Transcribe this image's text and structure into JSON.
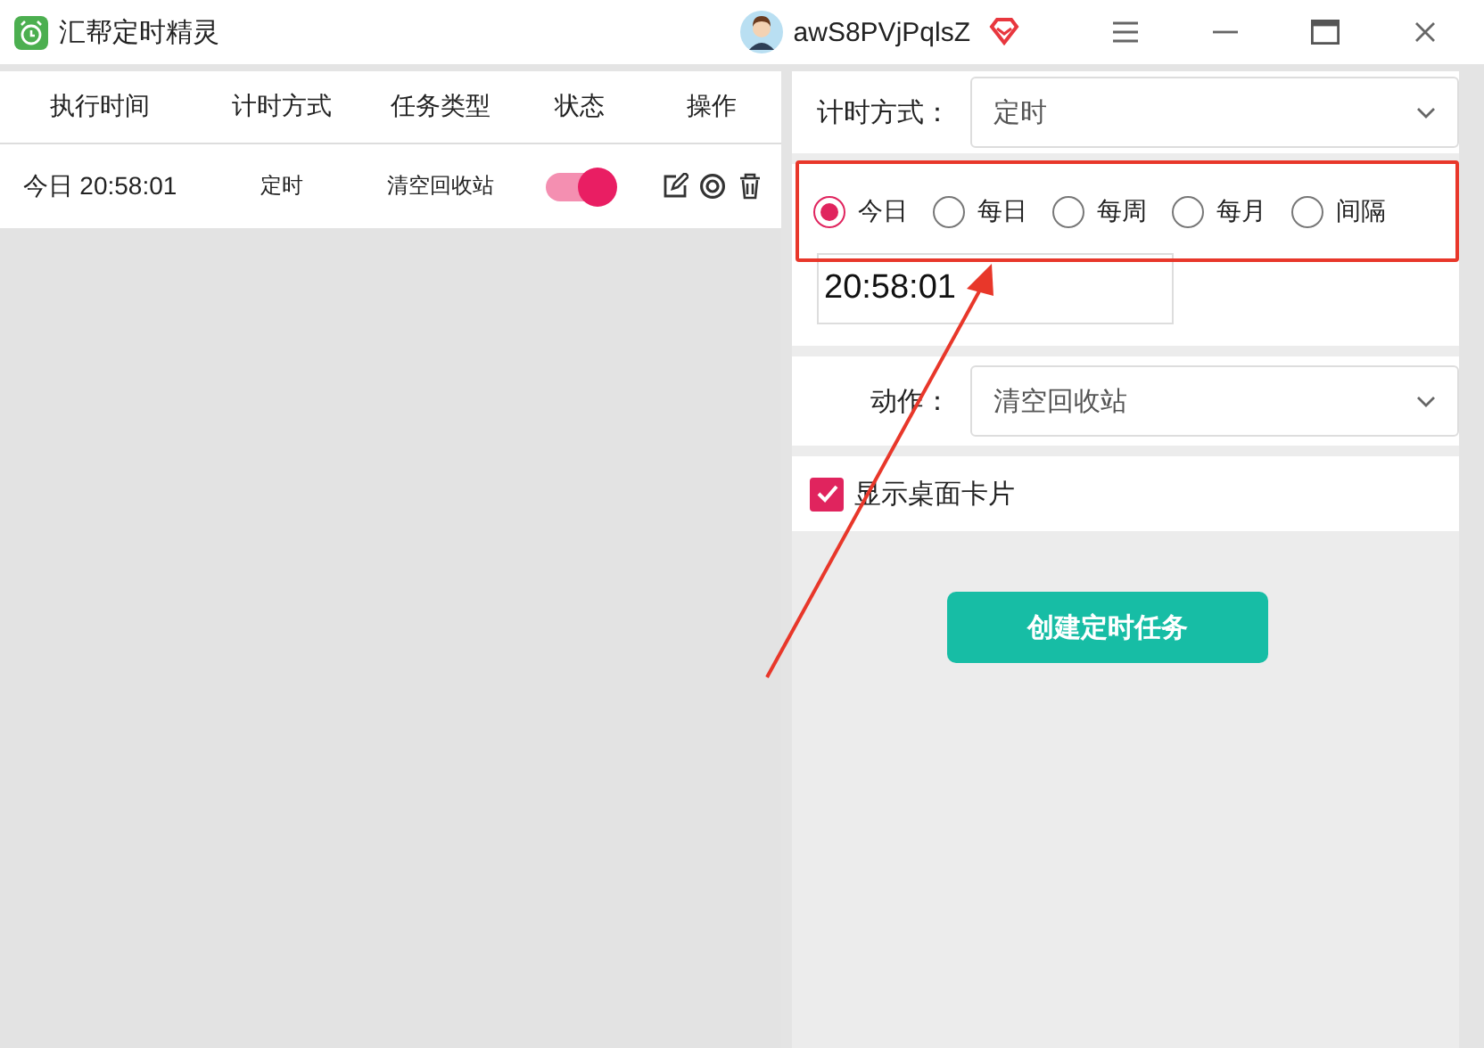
{
  "window": {
    "title": "汇帮定时精灵",
    "user": "awS8PVjPqlsZ"
  },
  "table": {
    "columns": [
      "执行时间",
      "计时方式",
      "任务类型",
      "状态",
      "操作"
    ],
    "rows": [
      {
        "time": "今日 20:58:01",
        "mode": "定时",
        "task": "清空回收站",
        "on": true
      }
    ]
  },
  "form": {
    "mode_label": "计时方式：",
    "mode_value": "定时",
    "frequency": [
      {
        "label": "今日",
        "selected": true
      },
      {
        "label": "每日",
        "selected": false
      },
      {
        "label": "每周",
        "selected": false
      },
      {
        "label": "每月",
        "selected": false
      },
      {
        "label": "间隔",
        "selected": false
      }
    ],
    "time_value": "20:58:01",
    "action_label": "动作：",
    "action_value": "清空回收站",
    "show_card": {
      "label": "显示桌面卡片",
      "checked": true
    },
    "submit": "创建定时任务"
  }
}
